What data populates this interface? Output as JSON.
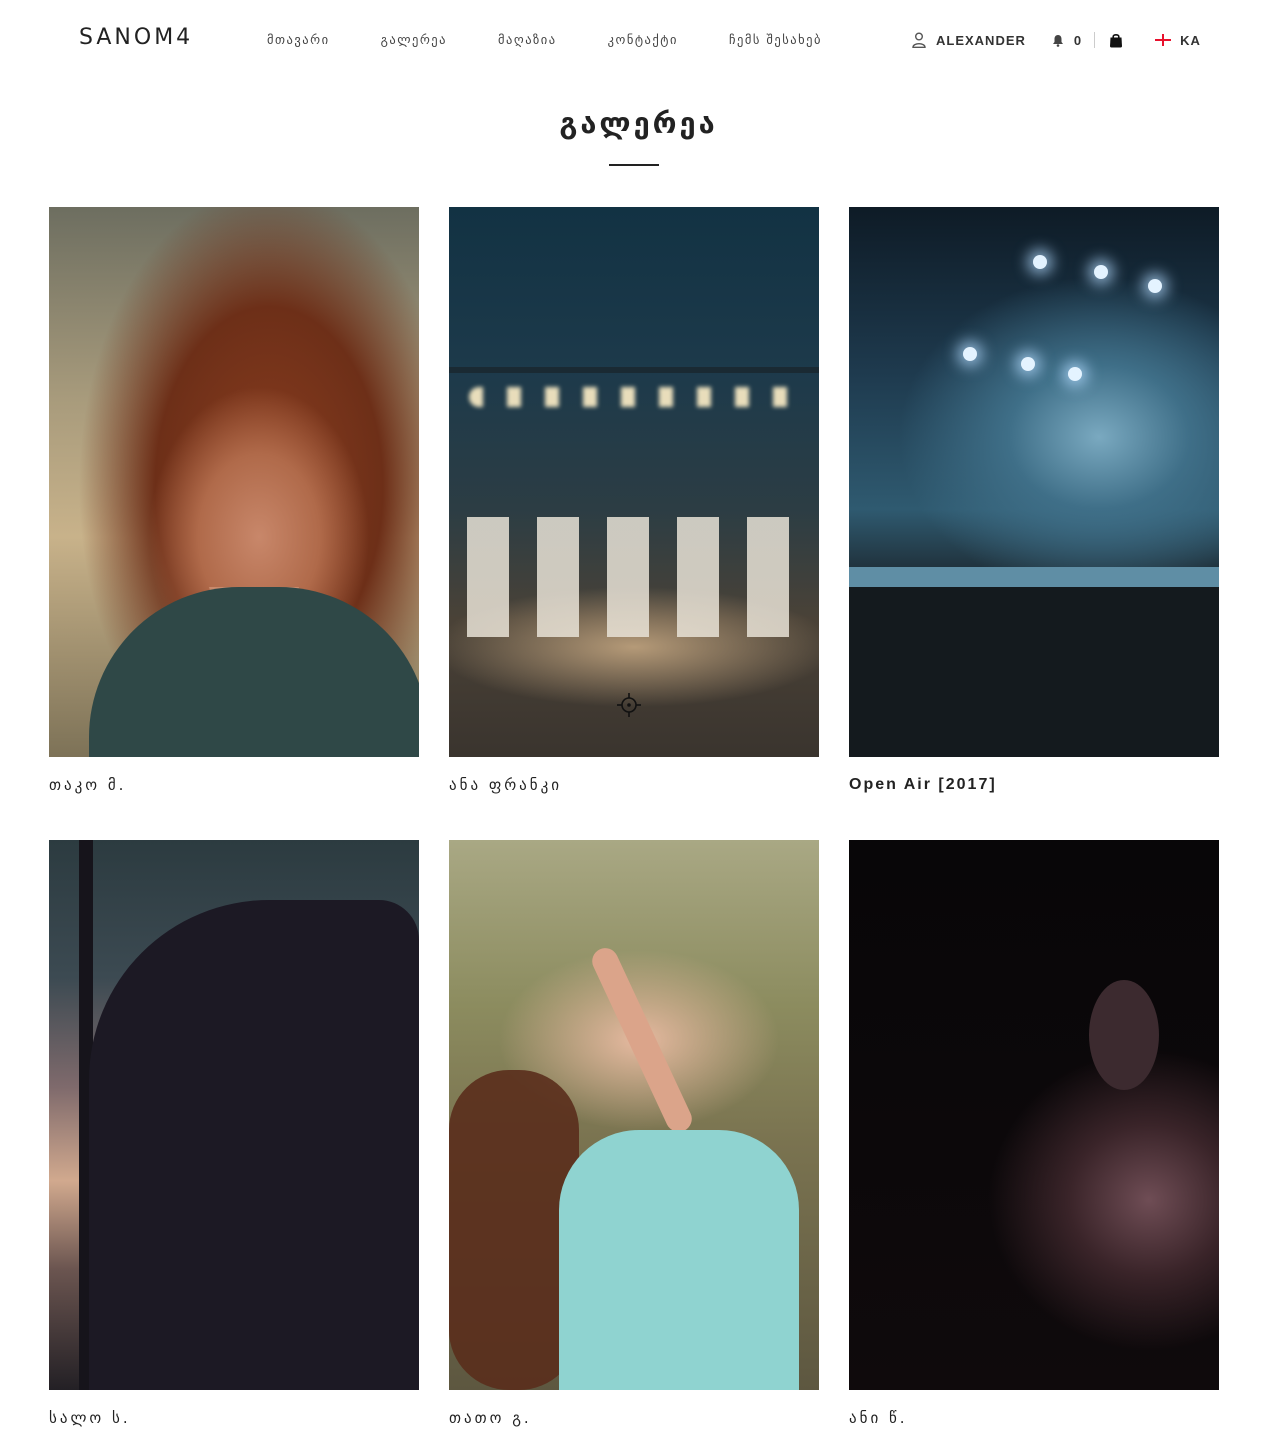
{
  "header": {
    "logo": "SANOM4",
    "nav": [
      "მთავარი",
      "გალერეა",
      "მაღაზია",
      "კონტაქტი",
      "ჩემს შესახებ"
    ],
    "user_name": "ALEXANDER",
    "notification_count": "0",
    "language": "KA"
  },
  "page": {
    "title": "გალერეა"
  },
  "gallery": [
    {
      "caption": "თაკო მ."
    },
    {
      "caption": "ანა ფრანკი"
    },
    {
      "caption": "Open Air [2017]"
    },
    {
      "caption": "სალო ს."
    },
    {
      "caption": "თათო გ."
    },
    {
      "caption": "ანი წ."
    }
  ]
}
